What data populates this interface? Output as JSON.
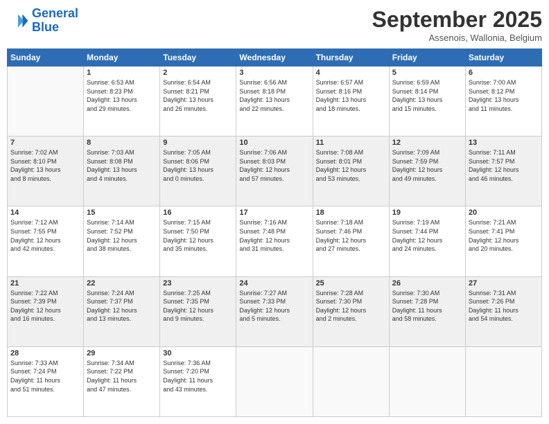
{
  "header": {
    "logo_line1": "General",
    "logo_line2": "Blue",
    "month": "September 2025",
    "location": "Assenois, Wallonia, Belgium"
  },
  "weekdays": [
    "Sunday",
    "Monday",
    "Tuesday",
    "Wednesday",
    "Thursday",
    "Friday",
    "Saturday"
  ],
  "weeks": [
    [
      {
        "day": "",
        "info": ""
      },
      {
        "day": "1",
        "info": "Sunrise: 6:53 AM\nSunset: 8:23 PM\nDaylight: 13 hours\nand 29 minutes."
      },
      {
        "day": "2",
        "info": "Sunrise: 6:54 AM\nSunset: 8:21 PM\nDaylight: 13 hours\nand 26 minutes."
      },
      {
        "day": "3",
        "info": "Sunrise: 6:56 AM\nSunset: 8:18 PM\nDaylight: 13 hours\nand 22 minutes."
      },
      {
        "day": "4",
        "info": "Sunrise: 6:57 AM\nSunset: 8:16 PM\nDaylight: 13 hours\nand 18 minutes."
      },
      {
        "day": "5",
        "info": "Sunrise: 6:59 AM\nSunset: 8:14 PM\nDaylight: 13 hours\nand 15 minutes."
      },
      {
        "day": "6",
        "info": "Sunrise: 7:00 AM\nSunset: 8:12 PM\nDaylight: 13 hours\nand 11 minutes."
      }
    ],
    [
      {
        "day": "7",
        "info": "Sunrise: 7:02 AM\nSunset: 8:10 PM\nDaylight: 13 hours\nand 8 minutes."
      },
      {
        "day": "8",
        "info": "Sunrise: 7:03 AM\nSunset: 8:08 PM\nDaylight: 13 hours\nand 4 minutes."
      },
      {
        "day": "9",
        "info": "Sunrise: 7:05 AM\nSunset: 8:06 PM\nDaylight: 13 hours\nand 0 minutes."
      },
      {
        "day": "10",
        "info": "Sunrise: 7:06 AM\nSunset: 8:03 PM\nDaylight: 12 hours\nand 57 minutes."
      },
      {
        "day": "11",
        "info": "Sunrise: 7:08 AM\nSunset: 8:01 PM\nDaylight: 12 hours\nand 53 minutes."
      },
      {
        "day": "12",
        "info": "Sunrise: 7:09 AM\nSunset: 7:59 PM\nDaylight: 12 hours\nand 49 minutes."
      },
      {
        "day": "13",
        "info": "Sunrise: 7:11 AM\nSunset: 7:57 PM\nDaylight: 12 hours\nand 46 minutes."
      }
    ],
    [
      {
        "day": "14",
        "info": "Sunrise: 7:12 AM\nSunset: 7:55 PM\nDaylight: 12 hours\nand 42 minutes."
      },
      {
        "day": "15",
        "info": "Sunrise: 7:14 AM\nSunset: 7:52 PM\nDaylight: 12 hours\nand 38 minutes."
      },
      {
        "day": "16",
        "info": "Sunrise: 7:15 AM\nSunset: 7:50 PM\nDaylight: 12 hours\nand 35 minutes."
      },
      {
        "day": "17",
        "info": "Sunrise: 7:16 AM\nSunset: 7:48 PM\nDaylight: 12 hours\nand 31 minutes."
      },
      {
        "day": "18",
        "info": "Sunrise: 7:18 AM\nSunset: 7:46 PM\nDaylight: 12 hours\nand 27 minutes."
      },
      {
        "day": "19",
        "info": "Sunrise: 7:19 AM\nSunset: 7:44 PM\nDaylight: 12 hours\nand 24 minutes."
      },
      {
        "day": "20",
        "info": "Sunrise: 7:21 AM\nSunset: 7:41 PM\nDaylight: 12 hours\nand 20 minutes."
      }
    ],
    [
      {
        "day": "21",
        "info": "Sunrise: 7:22 AM\nSunset: 7:39 PM\nDaylight: 12 hours\nand 16 minutes."
      },
      {
        "day": "22",
        "info": "Sunrise: 7:24 AM\nSunset: 7:37 PM\nDaylight: 12 hours\nand 13 minutes."
      },
      {
        "day": "23",
        "info": "Sunrise: 7:25 AM\nSunset: 7:35 PM\nDaylight: 12 hours\nand 9 minutes."
      },
      {
        "day": "24",
        "info": "Sunrise: 7:27 AM\nSunset: 7:33 PM\nDaylight: 12 hours\nand 5 minutes."
      },
      {
        "day": "25",
        "info": "Sunrise: 7:28 AM\nSunset: 7:30 PM\nDaylight: 12 hours\nand 2 minutes."
      },
      {
        "day": "26",
        "info": "Sunrise: 7:30 AM\nSunset: 7:28 PM\nDaylight: 11 hours\nand 58 minutes."
      },
      {
        "day": "27",
        "info": "Sunrise: 7:31 AM\nSunset: 7:26 PM\nDaylight: 11 hours\nand 54 minutes."
      }
    ],
    [
      {
        "day": "28",
        "info": "Sunrise: 7:33 AM\nSunset: 7:24 PM\nDaylight: 11 hours\nand 51 minutes."
      },
      {
        "day": "29",
        "info": "Sunrise: 7:34 AM\nSunset: 7:22 PM\nDaylight: 11 hours\nand 47 minutes."
      },
      {
        "day": "30",
        "info": "Sunrise: 7:36 AM\nSunset: 7:20 PM\nDaylight: 11 hours\nand 43 minutes."
      },
      {
        "day": "",
        "info": ""
      },
      {
        "day": "",
        "info": ""
      },
      {
        "day": "",
        "info": ""
      },
      {
        "day": "",
        "info": ""
      }
    ]
  ]
}
